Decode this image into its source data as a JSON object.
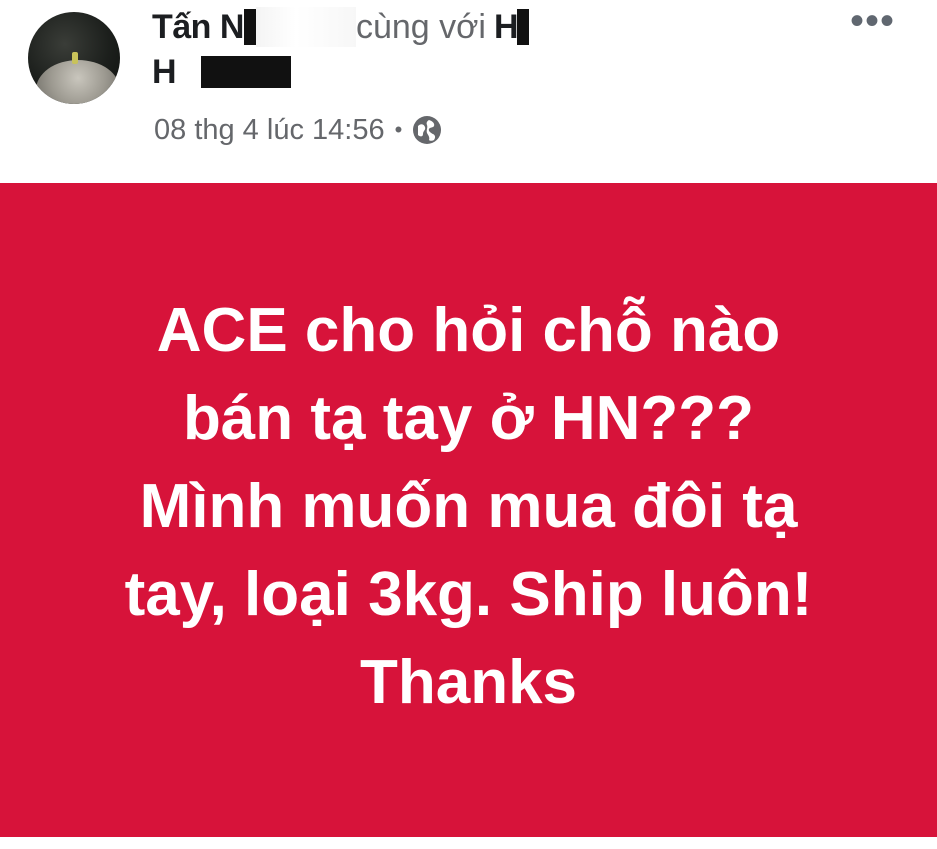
{
  "post": {
    "author_name_visible": "Tấn N",
    "with_text": "cùng với",
    "tagged_name_visible": "H",
    "tagged_line2_visible": "H",
    "timestamp": "08 thg 4 lúc 14:56",
    "separator": "•",
    "privacy_icon": "globe-icon",
    "more_label": "•••",
    "body_lines": [
      "ACE cho hỏi chỗ nào",
      "bán tạ tay ở HN???",
      "Mình muốn mua đôi tạ",
      "tay, loại 3kg. Ship luôn!",
      "Thanks"
    ]
  },
  "colors": {
    "background_post": "#d7133a",
    "text_on_post": "#ffffff",
    "name_color": "#1c1e21",
    "meta_color": "#65676b"
  }
}
